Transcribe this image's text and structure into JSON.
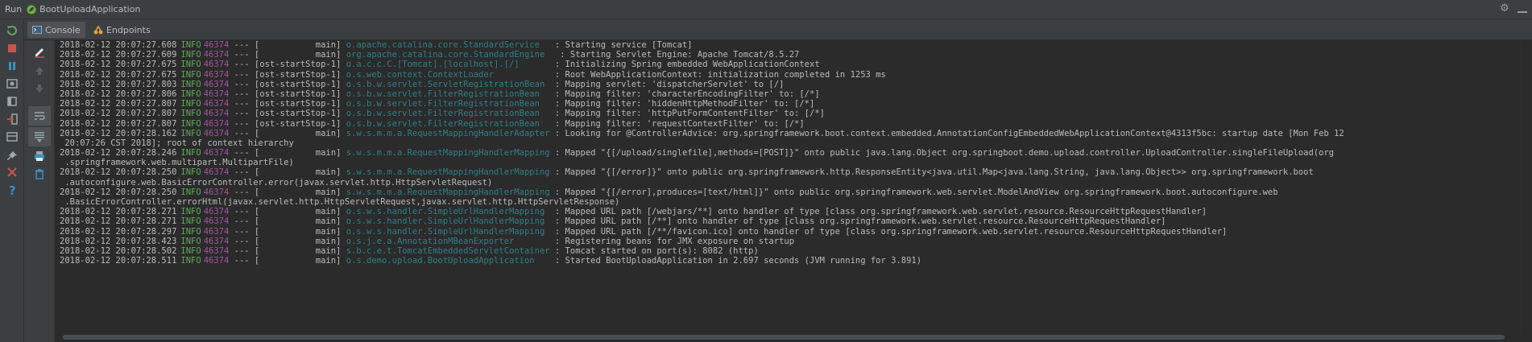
{
  "window": {
    "run_label": "Run",
    "app_name": "BootUploadApplication"
  },
  "tabs": [
    {
      "label": "Console",
      "icon": "console-icon",
      "active": true
    },
    {
      "label": "Endpoints",
      "icon": "endpoints-icon",
      "active": false
    }
  ],
  "log_lines": [
    {
      "ts": "2018-02-12 20:07:27.608",
      "level": "INFO",
      "pid": "46374",
      "sep": " --- [",
      "thread": "           main]",
      "src": " o.apache.catalina.core.StandardService  ",
      "msg": " : Starting service [Tomcat]"
    },
    {
      "ts": "2018-02-12 20:07:27.609",
      "level": "INFO",
      "pid": "46374",
      "sep": " --- [",
      "thread": "           main]",
      "src": " org.apache.catalina.core.StandardEngine  ",
      "msg": " : Starting Servlet Engine: Apache Tomcat/8.5.27"
    },
    {
      "ts": "2018-02-12 20:07:27.675",
      "level": "INFO",
      "pid": "46374",
      "sep": " --- [",
      "thread": "ost-startStop-1]",
      "src": " o.a.c.c.C.[Tomcat].[localhost].[/]      ",
      "msg": " : Initializing Spring embedded WebApplicationContext"
    },
    {
      "ts": "2018-02-12 20:07:27.675",
      "level": "INFO",
      "pid": "46374",
      "sep": " --- [",
      "thread": "ost-startStop-1]",
      "src": " o.s.web.context.ContextLoader           ",
      "msg": " : Root WebApplicationContext: initialization completed in 1253 ms"
    },
    {
      "ts": "2018-02-12 20:07:27.803",
      "level": "INFO",
      "pid": "46374",
      "sep": " --- [",
      "thread": "ost-startStop-1]",
      "src": " o.s.b.w.servlet.ServletRegistrationBean ",
      "msg": " : Mapping servlet: 'dispatcherServlet' to [/]"
    },
    {
      "ts": "2018-02-12 20:07:27.806",
      "level": "INFO",
      "pid": "46374",
      "sep": " --- [",
      "thread": "ost-startStop-1]",
      "src": " o.s.b.w.servlet.FilterRegistrationBean  ",
      "msg": " : Mapping filter: 'characterEncodingFilter' to: [/*]"
    },
    {
      "ts": "2018-02-12 20:07:27.807",
      "level": "INFO",
      "pid": "46374",
      "sep": " --- [",
      "thread": "ost-startStop-1]",
      "src": " o.s.b.w.servlet.FilterRegistrationBean  ",
      "msg": " : Mapping filter: 'hiddenHttpMethodFilter' to: [/*]"
    },
    {
      "ts": "2018-02-12 20:07:27.807",
      "level": "INFO",
      "pid": "46374",
      "sep": " --- [",
      "thread": "ost-startStop-1]",
      "src": " o.s.b.w.servlet.FilterRegistrationBean  ",
      "msg": " : Mapping filter: 'httpPutFormContentFilter' to: [/*]"
    },
    {
      "ts": "2018-02-12 20:07:27.807",
      "level": "INFO",
      "pid": "46374",
      "sep": " --- [",
      "thread": "ost-startStop-1]",
      "src": " o.s.b.w.servlet.FilterRegistrationBean  ",
      "msg": " : Mapping filter: 'requestContextFilter' to: [/*]"
    },
    {
      "ts": "2018-02-12 20:07:28.162",
      "level": "INFO",
      "pid": "46374",
      "sep": " --- [",
      "thread": "           main]",
      "src": " s.w.s.m.m.a.RequestMappingHandlerAdapter",
      "msg": " : Looking for @ControllerAdvice: org.springframework.boot.context.embedded.AnnotationConfigEmbeddedWebApplicationContext@4313f5bc: startup date [Mon Feb 12"
    },
    {
      "ts": "",
      "level": "",
      "pid": "",
      "sep": "",
      "thread": "",
      "src": "",
      "msg": " 20:07:26 CST 2018]; root of context hierarchy"
    },
    {
      "ts": "2018-02-12 20:07:28.246",
      "level": "INFO",
      "pid": "46374",
      "sep": " --- [",
      "thread": "           main]",
      "src": " s.w.s.m.m.a.RequestMappingHandlerMapping",
      "msg": " : Mapped \"{[/upload/singlefile],methods=[POST]}\" onto public java.lang.Object org.springboot.demo.upload.controller.UploadController.singleFileUpload(org"
    },
    {
      "ts": "",
      "level": "",
      "pid": "",
      "sep": "",
      "thread": "",
      "src": "",
      "msg": " .springframework.web.multipart.MultipartFile)"
    },
    {
      "ts": "2018-02-12 20:07:28.250",
      "level": "INFO",
      "pid": "46374",
      "sep": " --- [",
      "thread": "           main]",
      "src": " s.w.s.m.m.a.RequestMappingHandlerMapping",
      "msg": " : Mapped \"{[/error]}\" onto public org.springframework.http.ResponseEntity<java.util.Map<java.lang.String, java.lang.Object>> org.springframework.boot"
    },
    {
      "ts": "",
      "level": "",
      "pid": "",
      "sep": "",
      "thread": "",
      "src": "",
      "msg": " .autoconfigure.web.BasicErrorController.error(javax.servlet.http.HttpServletRequest)"
    },
    {
      "ts": "2018-02-12 20:07:28.250",
      "level": "INFO",
      "pid": "46374",
      "sep": " --- [",
      "thread": "           main]",
      "src": " s.w.s.m.m.a.RequestMappingHandlerMapping",
      "msg": " : Mapped \"{[/error],produces=[text/html]}\" onto public org.springframework.web.servlet.ModelAndView org.springframework.boot.autoconfigure.web"
    },
    {
      "ts": "",
      "level": "",
      "pid": "",
      "sep": "",
      "thread": "",
      "src": "",
      "msg": " .BasicErrorController.errorHtml(javax.servlet.http.HttpServletRequest,javax.servlet.http.HttpServletResponse)"
    },
    {
      "ts": "2018-02-12 20:07:28.271",
      "level": "INFO",
      "pid": "46374",
      "sep": " --- [",
      "thread": "           main]",
      "src": " o.s.w.s.handler.SimpleUrlHandlerMapping ",
      "msg": " : Mapped URL path [/webjars/**] onto handler of type [class org.springframework.web.servlet.resource.ResourceHttpRequestHandler]"
    },
    {
      "ts": "2018-02-12 20:07:28.271",
      "level": "INFO",
      "pid": "46374",
      "sep": " --- [",
      "thread": "           main]",
      "src": " o.s.w.s.handler.SimpleUrlHandlerMapping ",
      "msg": " : Mapped URL path [/**] onto handler of type [class org.springframework.web.servlet.resource.ResourceHttpRequestHandler]"
    },
    {
      "ts": "2018-02-12 20:07:28.297",
      "level": "INFO",
      "pid": "46374",
      "sep": " --- [",
      "thread": "           main]",
      "src": " o.s.w.s.handler.SimpleUrlHandlerMapping ",
      "msg": " : Mapped URL path [/**/favicon.ico] onto handler of type [class org.springframework.web.servlet.resource.ResourceHttpRequestHandler]"
    },
    {
      "ts": "2018-02-12 20:07:28.423",
      "level": "INFO",
      "pid": "46374",
      "sep": " --- [",
      "thread": "           main]",
      "src": " o.s.j.e.a.AnnotationMBeanExporter       ",
      "msg": " : Registering beans for JMX exposure on startup"
    },
    {
      "ts": "2018-02-12 20:07:28.502",
      "level": "INFO",
      "pid": "46374",
      "sep": " --- [",
      "thread": "           main]",
      "src": " s.b.c.e.t.TomcatEmbeddedServletContainer",
      "msg": " : Tomcat started on port(s): 8082 (http)"
    },
    {
      "ts": "2018-02-12 20:07:28.511",
      "level": "INFO",
      "pid": "46374",
      "sep": " --- [",
      "thread": "           main]",
      "src": " o.s.demo.upload.BootUploadApplication   ",
      "msg": " : Started BootUploadApplication in 2.697 seconds (JVM running for 3.891)"
    }
  ],
  "colors": {
    "level_info": "#5daa57",
    "pid": "#a1539f",
    "logger_source": "#2e7f87",
    "console_bg": "#2b2b2b",
    "panel_bg": "#3c3f41"
  }
}
